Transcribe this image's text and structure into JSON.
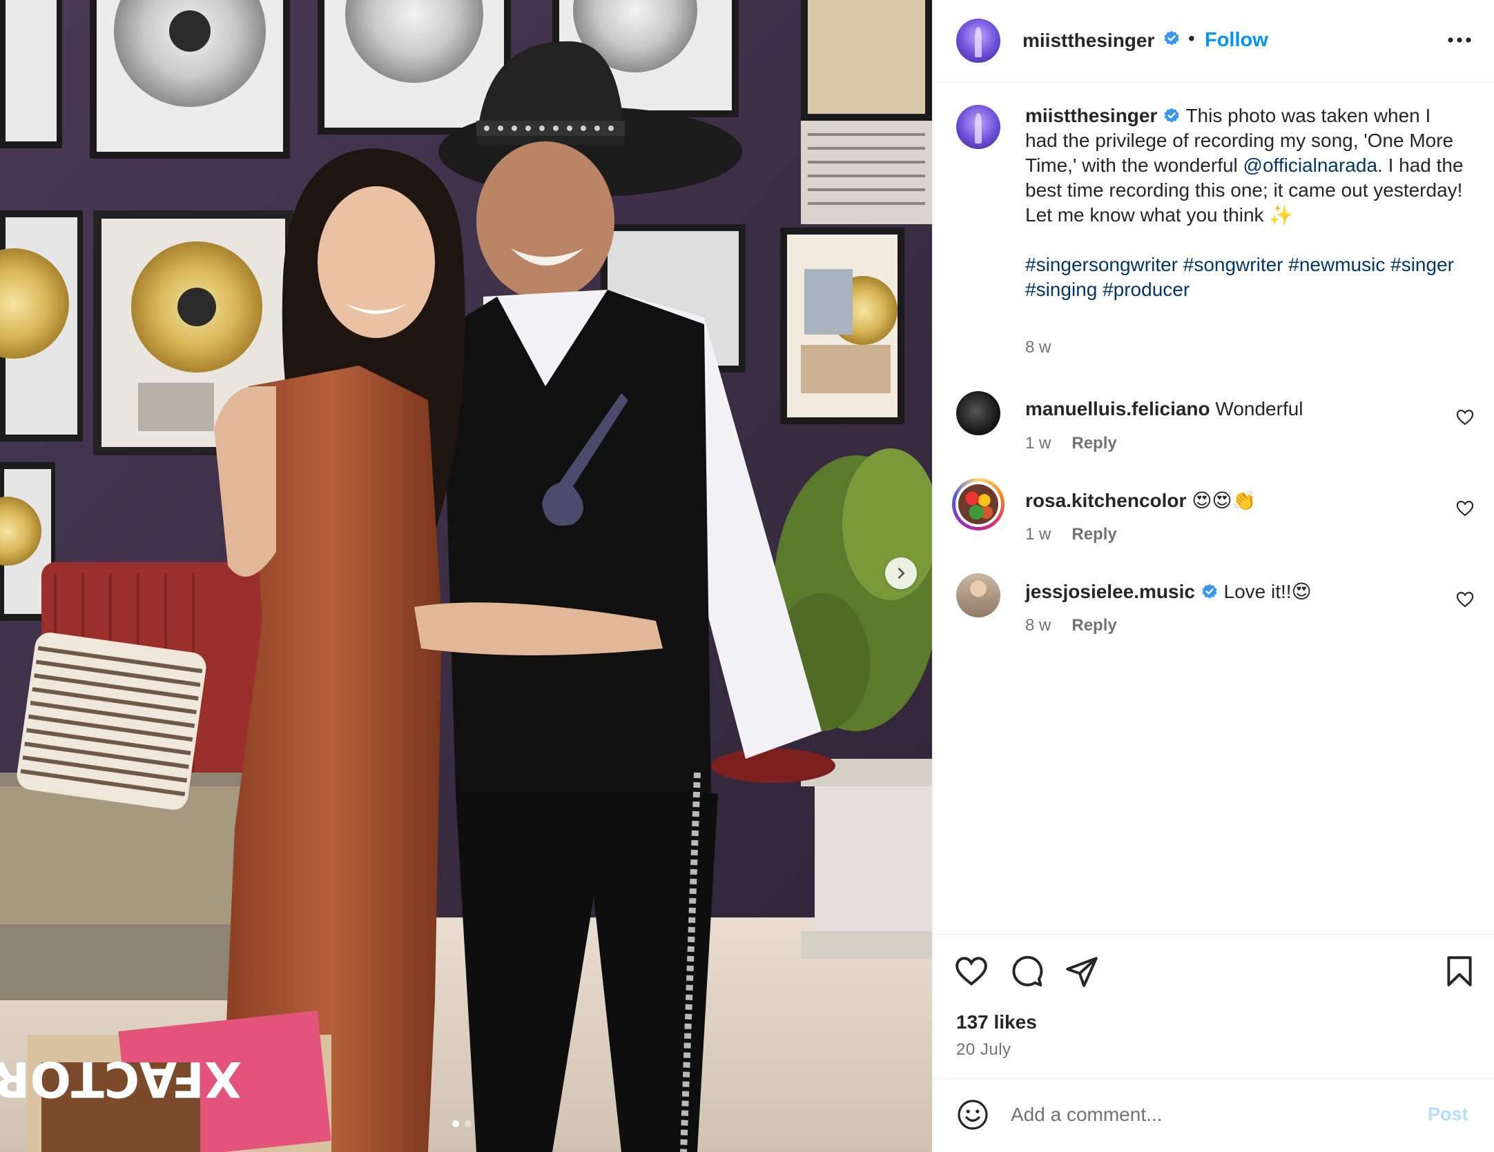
{
  "post": {
    "username": "miistthesinger",
    "follow_label": "Follow",
    "separator": "•",
    "caption_text": " This photo was taken when I had the privilege of recording my song, 'One More Time,' with the wonderful ",
    "mention": "@officialnarada",
    "caption_text_2": ". I had the best time recording this one; it came out yesterday! Let me know what you think ✨",
    "hashtags": "#singersongwriter #songwriter #newmusic #singer #singing #producer",
    "caption_time": "8 w",
    "likes": "137 likes",
    "date": "20 July",
    "image_slides": {
      "current": 1,
      "total": 2
    }
  },
  "comments": [
    {
      "username": "manuelluis.feliciano",
      "text": "Wonderful",
      "time": "1 w",
      "reply_label": "Reply",
      "verified": false
    },
    {
      "username": "rosa.kitchencolor",
      "text": "😍😍👏",
      "time": "1 w",
      "reply_label": "Reply",
      "verified": false
    },
    {
      "username": "jessjosielee.music",
      "text": "Love it!!😍",
      "time": "8 w",
      "reply_label": "Reply",
      "verified": true
    }
  ],
  "composer": {
    "placeholder": "Add a comment...",
    "post_label": "Post"
  },
  "icons": {
    "more": "more-horizontal-icon",
    "verified": "verified-badge-icon",
    "like": "heart-icon",
    "comment": "comment-icon",
    "share": "paper-plane-icon",
    "save": "bookmark-icon",
    "emoji": "emoji-icon",
    "next": "chevron-right-icon"
  },
  "colors": {
    "accent": "#0095f6",
    "link": "#00376b",
    "muted": "#737373",
    "verified": "#3897f0"
  }
}
